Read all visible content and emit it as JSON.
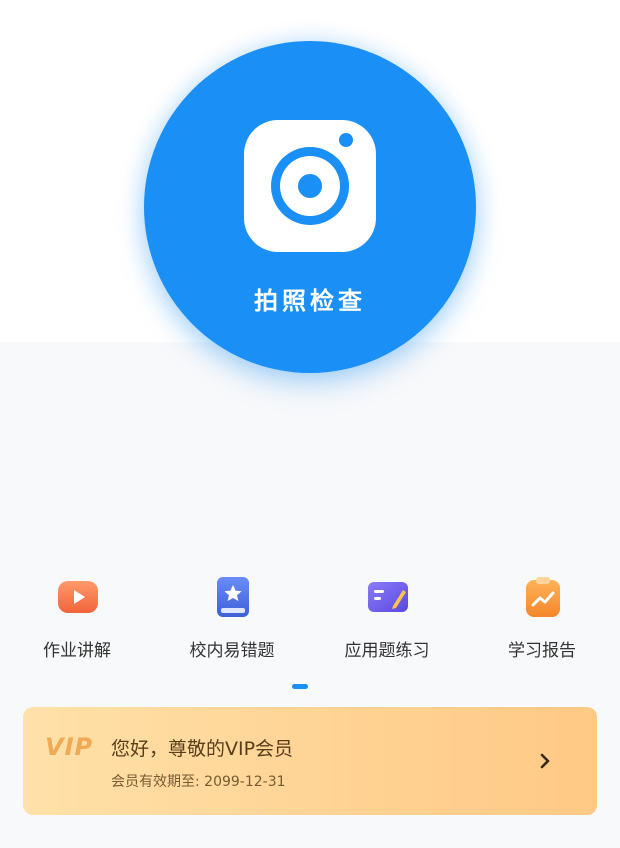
{
  "camera": {
    "label": "拍照检查",
    "icon": "camera-icon",
    "color": "#1a8ff5"
  },
  "features": [
    {
      "label": "作业讲解",
      "icon": "play-video-icon",
      "color": "#f7734a"
    },
    {
      "label": "校内易错题",
      "icon": "star-book-icon",
      "color": "#4f73ea"
    },
    {
      "label": "应用题练习",
      "icon": "pencil-card-icon",
      "color": "#6e5cf0"
    },
    {
      "label": "学习报告",
      "icon": "trend-clipboard-icon",
      "color": "#f7953a"
    }
  ],
  "pager": {
    "pages": 1,
    "active": 1
  },
  "vip": {
    "logo": "VIP",
    "greeting": "您好，尊敬的VIP会员",
    "expiry": "会员有效期至: 2099-12-31",
    "icon": "chevron-right-icon"
  }
}
